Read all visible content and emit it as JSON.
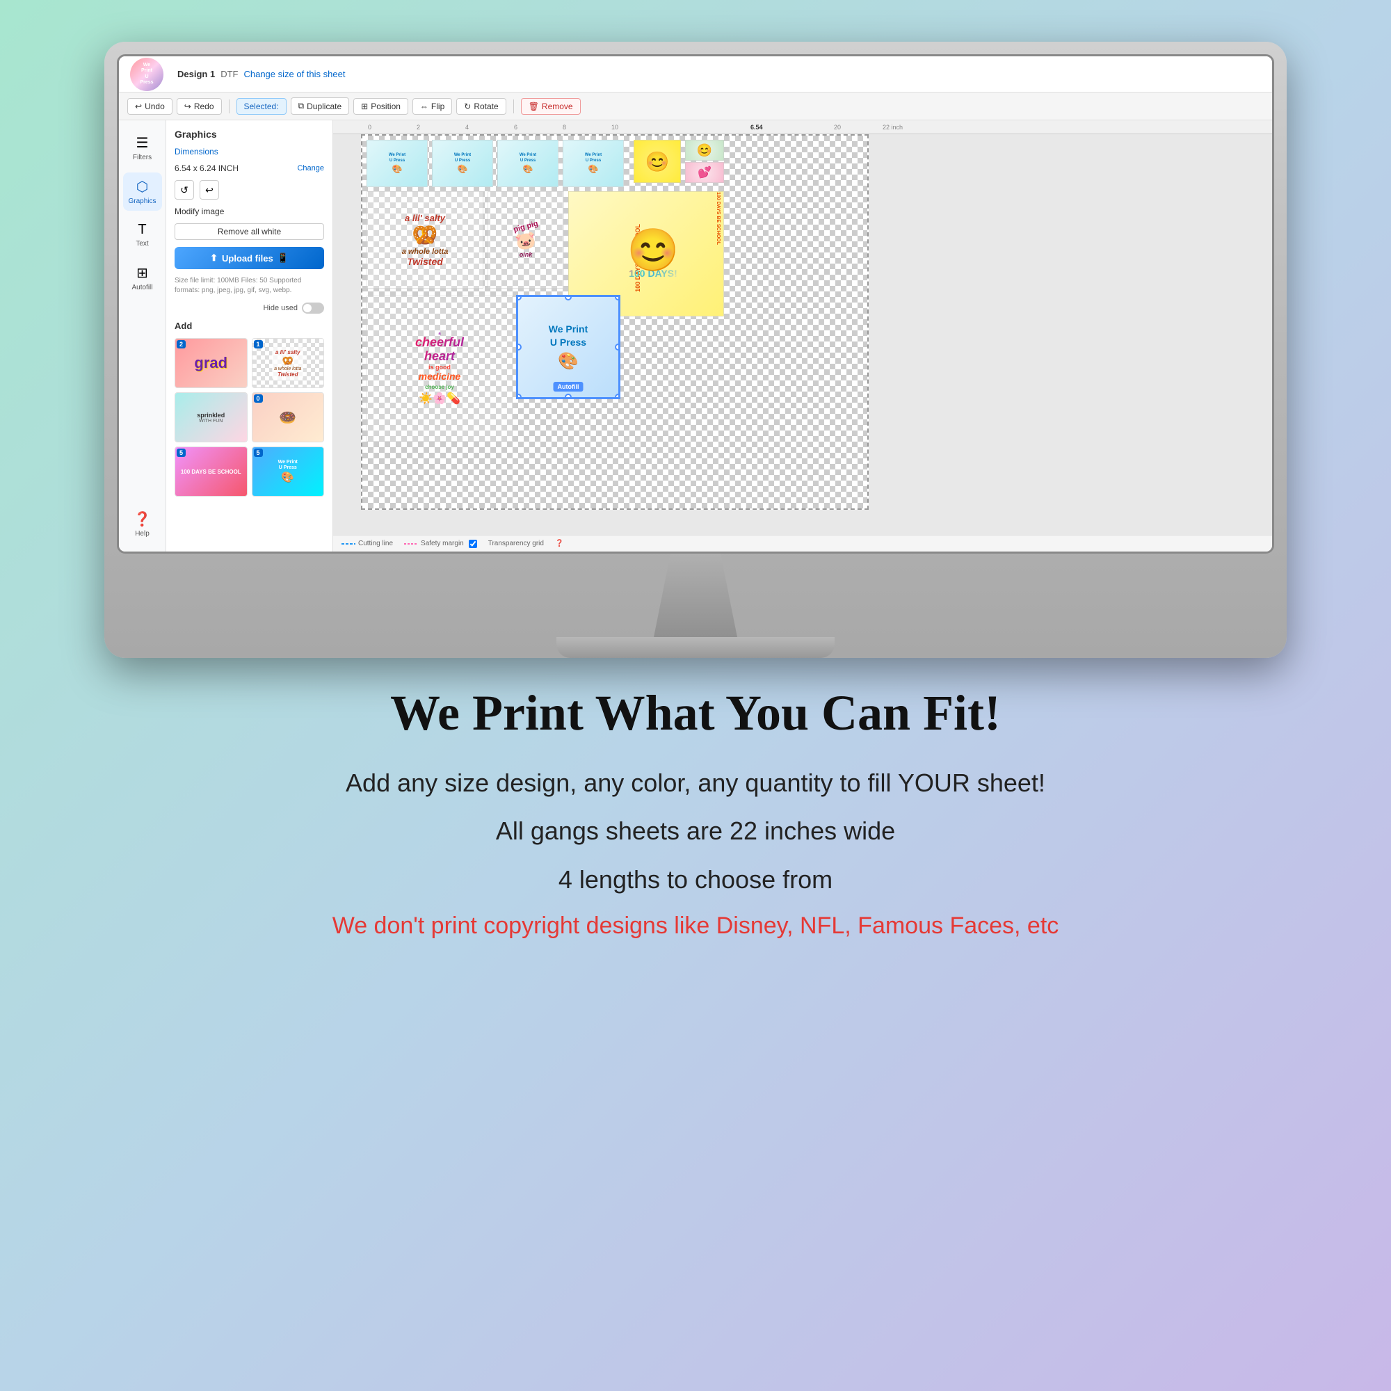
{
  "app": {
    "logo_text": "We Print U Press",
    "design_label": "Design 1",
    "design_type": "DTF",
    "change_size_label": "Change size of this sheet"
  },
  "toolbar": {
    "undo_label": "Undo",
    "redo_label": "Redo",
    "selected_label": "Selected:",
    "duplicate_label": "Duplicate",
    "position_label": "Position",
    "flip_label": "Flip",
    "rotate_label": "Rotate",
    "remove_label": "Remove"
  },
  "sidebar": {
    "filters_label": "Filters",
    "graphics_label": "Graphics",
    "text_label": "Text",
    "autofill_label": "Autofill"
  },
  "panel": {
    "title": "Graphics",
    "dimensions_label": "Dimensions",
    "dim_value": "6.54 x 6.24 INCH",
    "change_label": "Change",
    "modify_label": "Modify image",
    "remove_white_label": "Remove all white",
    "upload_label": "Upload files",
    "file_limits": "Size file limit: 100MB Files: 50 Supported formats: png, jpeg, jpg, gif, svg, webp.",
    "hide_used_label": "Hide used",
    "add_label": "Add"
  },
  "canvas": {
    "ruler_numbers": [
      "0",
      "2",
      "4",
      "6",
      "8",
      "10",
      "20",
      "22 inch"
    ],
    "size_indicator": "6.54",
    "cutting_line_label": "Cutting line",
    "safety_margin_label": "Safety margin",
    "transparency_label": "Transparency grid",
    "help_label": "Help",
    "stickers": [
      {
        "id": "we-print-1",
        "text": "We Print U Press",
        "color": "#4facfe"
      },
      {
        "id": "salty",
        "text": "a lil' salty a whole lotta Twisted",
        "color": "#ff9a9e"
      },
      {
        "id": "100days",
        "text": "100 DAYS BE SCHOOL",
        "color": "#ffcc02"
      },
      {
        "id": "cheerful",
        "text": "a cheerful heart is good medicine",
        "color": "#f093fb"
      },
      {
        "id": "we-print-2",
        "text": "We Print U Press",
        "color": "#4facfe"
      },
      {
        "id": "pig-pig",
        "text": "pig pig",
        "color": "#ffecd2"
      }
    ]
  },
  "thumbnails": [
    {
      "id": "thumb-grad",
      "badge": "2",
      "text": "grad",
      "color": "#c8b8e8"
    },
    {
      "id": "thumb-salty",
      "badge": "1",
      "text": "a lil' salty",
      "color": "#ffcc80"
    },
    {
      "id": "thumb-sprinkled",
      "badge": "",
      "text": "sprinkled with fun",
      "color": "#a8edea"
    },
    {
      "id": "thumb-donut",
      "badge": "0",
      "text": "donut",
      "color": "#fad0c4"
    },
    {
      "id": "thumb-days",
      "badge": "5",
      "text": "100 days",
      "color": "#f5576c"
    },
    {
      "id": "thumb-weprint",
      "badge": "5",
      "text": "We Print U Press",
      "color": "#4facfe"
    }
  ],
  "bottom": {
    "headline": "We Print What You Can Fit!",
    "line1": "Add any size design, any color, any quantity to fill YOUR sheet!",
    "line2": "All gangs sheets are 22 inches wide",
    "line3": "4 lengths to choose from",
    "line4": "We don't print copyright designs like Disney, NFL, Famous Faces, etc"
  }
}
